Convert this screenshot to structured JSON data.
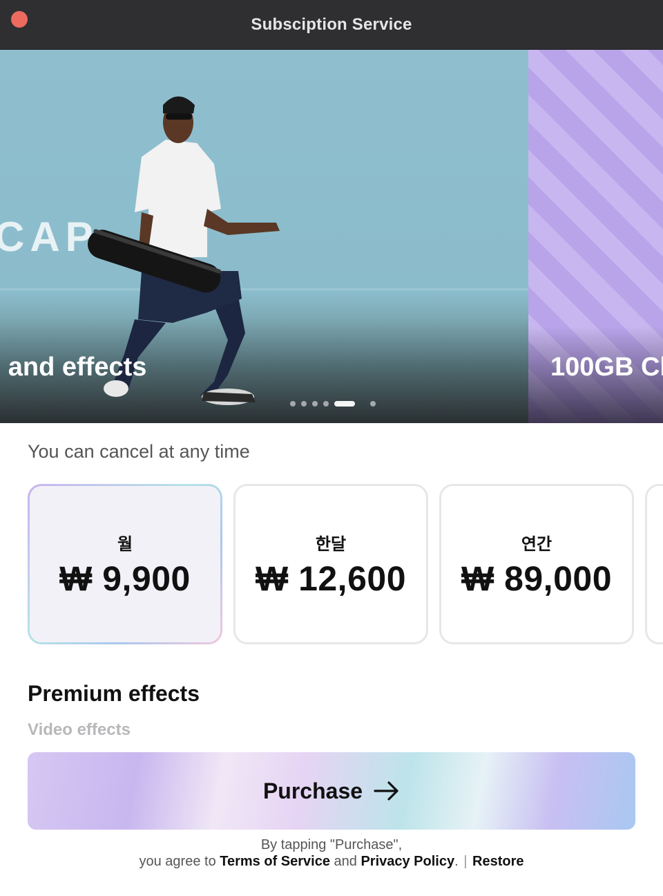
{
  "window": {
    "title": "Subsciption Service"
  },
  "banner": {
    "slides": [
      {
        "caption": "n and effects",
        "ghost_text": "CAP"
      },
      {
        "caption": "100GB Cl"
      }
    ],
    "dot_count": 6,
    "active_dot": 4
  },
  "cancel_note": "You can cancel at any time",
  "plans": [
    {
      "name": "월",
      "price": "₩ 9,900",
      "selected": true
    },
    {
      "name": "한달",
      "price": "₩ 12,600",
      "selected": false
    },
    {
      "name": "연간",
      "price": "₩ 89,000",
      "selected": false
    }
  ],
  "features": {
    "title": "Premium effects",
    "subtitle": "Video effects"
  },
  "purchase_button": {
    "label": "Purchase",
    "icon": "arrow-right-icon"
  },
  "legal": {
    "line1": "By tapping \"Purchase\",",
    "prefix": "you agree to ",
    "terms": "Terms of Service",
    "and": " and ",
    "privacy": "Privacy Policy",
    "period": ".",
    "separator": "|",
    "restore": "Restore"
  },
  "colors": {
    "titlebar": "#2f2f31",
    "close_button": "#ed6a5e",
    "banner_bg": "#8fbfcf",
    "next_slide_bg": "#b9a4ea"
  }
}
